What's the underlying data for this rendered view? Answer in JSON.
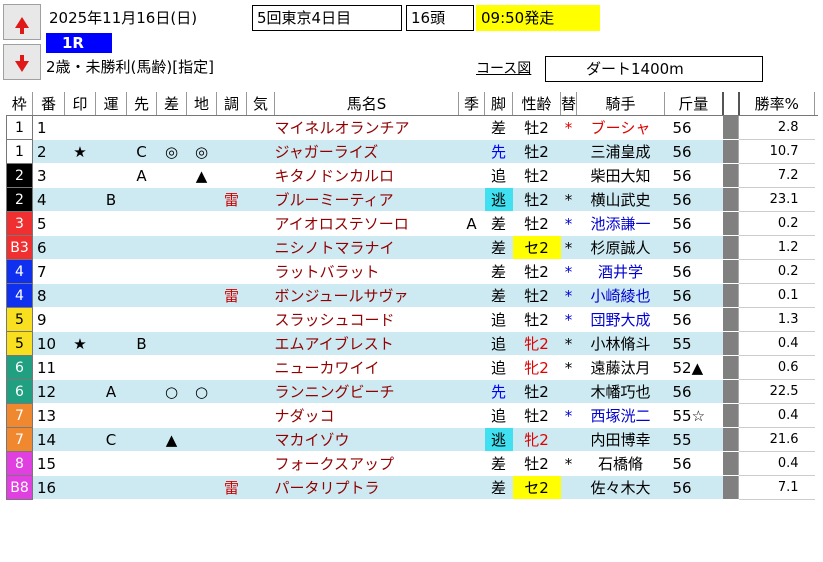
{
  "race": {
    "date": "2025年11月16日(日)",
    "meeting": "5回東京4日目",
    "runners": "16頭",
    "start": "09:50発走",
    "number": "1R",
    "condition": "2歳・未勝利(馬齢)[指定]",
    "course_link": "コース図",
    "course": "ダート1400m"
  },
  "colors": {
    "start_bg": "#ffff00",
    "race_num_bg": "#0000ff",
    "alt_row_bg": "#cdeaf2",
    "name_color": "#900000",
    "apprentice_color": "#0000d0"
  },
  "columns": [
    "枠",
    "番",
    "印",
    "運",
    "先",
    "差",
    "地",
    "調",
    "気",
    "馬名S",
    "季",
    "脚",
    "性齢",
    "替",
    "騎手",
    "斤量",
    "",
    "勝率%"
  ],
  "rows": [
    {
      "waku": "1",
      "wakuBg": "#ffffff",
      "wakuFg": "#000000",
      "num": "1",
      "in": "",
      "un": "",
      "sen": "",
      "sa": "",
      "chi": "",
      "cho": "",
      "ki": "",
      "name": "マイネルオランチア",
      "kisetsu": "",
      "style": "差",
      "styleBg": "",
      "styleFg": "#000000",
      "sex": "牡2",
      "sexBg": "",
      "sexFg": "#000000",
      "kae": "*",
      "jockey": "ブーシャ",
      "jockeyFg": "#e00000",
      "weight": "56",
      "odds": "2.8"
    },
    {
      "waku": "1",
      "wakuBg": "#ffffff",
      "wakuFg": "#000000",
      "num": "2",
      "in": "★",
      "un": "",
      "sen": "C",
      "sa": "◎",
      "chi": "◎",
      "cho": "",
      "ki": "",
      "name": "ジャガーライズ",
      "kisetsu": "",
      "style": "先",
      "styleBg": "",
      "styleFg": "#0000ff",
      "sex": "牡2",
      "sexBg": "",
      "sexFg": "#000000",
      "kae": "",
      "jockey": "三浦皇成",
      "jockeyFg": "#000000",
      "weight": "56",
      "odds": "10.7"
    },
    {
      "waku": "2",
      "wakuBg": "#000000",
      "wakuFg": "#ffffff",
      "num": "3",
      "in": "",
      "un": "",
      "sen": "A",
      "sa": "",
      "chi": "▲",
      "cho": "",
      "ki": "",
      "name": "キタノドンカルロ",
      "kisetsu": "",
      "style": "追",
      "styleBg": "",
      "styleFg": "#000000",
      "sex": "牡2",
      "sexBg": "",
      "sexFg": "#000000",
      "kae": "",
      "jockey": "柴田大知",
      "jockeyFg": "#000000",
      "weight": "56",
      "odds": "7.2"
    },
    {
      "waku": "2",
      "wakuBg": "#000000",
      "wakuFg": "#ffffff",
      "num": "4",
      "in": "",
      "un": "B",
      "sen": "",
      "sa": "",
      "chi": "",
      "cho": "雷",
      "ki": "",
      "name": "ブルーミーティア",
      "kisetsu": "",
      "style": "逃",
      "styleBg": "#40e0f0",
      "styleFg": "#000000",
      "sex": "牡2",
      "sexBg": "",
      "sexFg": "#000000",
      "kae": "*",
      "jockey": "横山武史",
      "jockeyFg": "#000000",
      "weight": "56",
      "odds": "23.1"
    },
    {
      "waku": "3",
      "wakuBg": "#f03030",
      "wakuFg": "#ffffff",
      "num": "5",
      "in": "",
      "un": "",
      "sen": "",
      "sa": "",
      "chi": "",
      "cho": "",
      "ki": "",
      "name": "アイオロステソーロ",
      "kisetsu": "A",
      "style": "差",
      "styleBg": "",
      "styleFg": "#000000",
      "sex": "牡2",
      "sexBg": "",
      "sexFg": "#000000",
      "kae": "*",
      "jockey": "池添謙一",
      "jockeyFg": "#0000d0",
      "weight": "56",
      "odds": "0.2"
    },
    {
      "waku": "B3",
      "wakuBg": "#f03030",
      "wakuFg": "#ffffff",
      "num": "6",
      "in": "",
      "un": "",
      "sen": "",
      "sa": "",
      "chi": "",
      "cho": "",
      "ki": "",
      "name": "ニシノトマラナイ",
      "kisetsu": "",
      "style": "差",
      "styleBg": "",
      "styleFg": "#000000",
      "sex": "セ2",
      "sexBg": "#ffff00",
      "sexFg": "#000000",
      "kae": "*",
      "jockey": "杉原誠人",
      "jockeyFg": "#000000",
      "weight": "56",
      "odds": "1.2"
    },
    {
      "waku": "4",
      "wakuBg": "#1030f0",
      "wakuFg": "#ffffff",
      "num": "7",
      "in": "",
      "un": "",
      "sen": "",
      "sa": "",
      "chi": "",
      "cho": "",
      "ki": "",
      "name": "ラットバラット",
      "kisetsu": "",
      "style": "差",
      "styleBg": "",
      "styleFg": "#000000",
      "sex": "牡2",
      "sexBg": "",
      "sexFg": "#000000",
      "kae": "*",
      "jockey": "酒井学",
      "jockeyFg": "#0000d0",
      "weight": "56",
      "odds": "0.2"
    },
    {
      "waku": "4",
      "wakuBg": "#1030f0",
      "wakuFg": "#ffffff",
      "num": "8",
      "in": "",
      "un": "",
      "sen": "",
      "sa": "",
      "chi": "",
      "cho": "雷",
      "ki": "",
      "name": "ボンジュールサヴァ",
      "kisetsu": "",
      "style": "差",
      "styleBg": "",
      "styleFg": "#000000",
      "sex": "牡2",
      "sexBg": "",
      "sexFg": "#000000",
      "kae": "*",
      "jockey": "小崎綾也",
      "jockeyFg": "#0000d0",
      "weight": "56",
      "odds": "0.1"
    },
    {
      "waku": "5",
      "wakuBg": "#f8e020",
      "wakuFg": "#000000",
      "num": "9",
      "in": "",
      "un": "",
      "sen": "",
      "sa": "",
      "chi": "",
      "cho": "",
      "ki": "",
      "name": "スラッシュコード",
      "kisetsu": "",
      "style": "追",
      "styleBg": "",
      "styleFg": "#000000",
      "sex": "牡2",
      "sexBg": "",
      "sexFg": "#000000",
      "kae": "*",
      "jockey": "団野大成",
      "jockeyFg": "#0000d0",
      "weight": "56",
      "odds": "1.3"
    },
    {
      "waku": "5",
      "wakuBg": "#f8e020",
      "wakuFg": "#000000",
      "num": "10",
      "in": "★",
      "un": "",
      "sen": "B",
      "sa": "",
      "chi": "",
      "cho": "",
      "ki": "",
      "name": "エムアイブレスト",
      "kisetsu": "",
      "style": "追",
      "styleBg": "",
      "styleFg": "#000000",
      "sex": "牝2",
      "sexBg": "",
      "sexFg": "#e00000",
      "kae": "*",
      "jockey": "小林脩斗",
      "jockeyFg": "#000000",
      "weight": "55",
      "odds": "0.4"
    },
    {
      "waku": "6",
      "wakuBg": "#20a080",
      "wakuFg": "#ffffff",
      "num": "11",
      "in": "",
      "un": "",
      "sen": "",
      "sa": "",
      "chi": "",
      "cho": "",
      "ki": "",
      "name": "ニューカワイイ",
      "kisetsu": "",
      "style": "追",
      "styleBg": "",
      "styleFg": "#000000",
      "sex": "牝2",
      "sexBg": "",
      "sexFg": "#e00000",
      "kae": "*",
      "jockey": "遠藤汰月",
      "jockeyFg": "#000000",
      "weight": "52▲",
      "odds": "0.6"
    },
    {
      "waku": "6",
      "wakuBg": "#20a080",
      "wakuFg": "#ffffff",
      "num": "12",
      "in": "",
      "un": "A",
      "sen": "",
      "sa": "○",
      "chi": "○",
      "cho": "",
      "ki": "",
      "name": "ランニングビーチ",
      "kisetsu": "",
      "style": "先",
      "styleBg": "",
      "styleFg": "#0000ff",
      "sex": "牡2",
      "sexBg": "",
      "sexFg": "#000000",
      "kae": "",
      "jockey": "木幡巧也",
      "jockeyFg": "#000000",
      "weight": "56",
      "odds": "22.5"
    },
    {
      "waku": "7",
      "wakuBg": "#f08830",
      "wakuFg": "#ffffff",
      "num": "13",
      "in": "",
      "un": "",
      "sen": "",
      "sa": "",
      "chi": "",
      "cho": "",
      "ki": "",
      "name": "ナダッコ",
      "kisetsu": "",
      "style": "追",
      "styleBg": "",
      "styleFg": "#000000",
      "sex": "牡2",
      "sexBg": "",
      "sexFg": "#000000",
      "kae": "*",
      "jockey": "西塚洸二",
      "jockeyFg": "#0000d0",
      "weight": "55☆",
      "odds": "0.4"
    },
    {
      "waku": "7",
      "wakuBg": "#f08830",
      "wakuFg": "#ffffff",
      "num": "14",
      "in": "",
      "un": "C",
      "sen": "",
      "sa": "▲",
      "chi": "",
      "cho": "",
      "ki": "",
      "name": "マカイゾウ",
      "kisetsu": "",
      "style": "逃",
      "styleBg": "#40e0f0",
      "styleFg": "#000000",
      "sex": "牝2",
      "sexBg": "",
      "sexFg": "#e00000",
      "kae": "",
      "jockey": "内田博幸",
      "jockeyFg": "#000000",
      "weight": "55",
      "odds": "21.6"
    },
    {
      "waku": "8",
      "wakuBg": "#e040e0",
      "wakuFg": "#ffffff",
      "num": "15",
      "in": "",
      "un": "",
      "sen": "",
      "sa": "",
      "chi": "",
      "cho": "",
      "ki": "",
      "name": "フォークスアップ",
      "kisetsu": "",
      "style": "差",
      "styleBg": "",
      "styleFg": "#000000",
      "sex": "牡2",
      "sexBg": "",
      "sexFg": "#000000",
      "kae": "*",
      "jockey": "石橋脩",
      "jockeyFg": "#000000",
      "weight": "56",
      "odds": "0.4"
    },
    {
      "waku": "B8",
      "wakuBg": "#e040e0",
      "wakuFg": "#ffffff",
      "num": "16",
      "in": "",
      "un": "",
      "sen": "",
      "sa": "",
      "chi": "",
      "cho": "雷",
      "ki": "",
      "name": "パータリプトラ",
      "kisetsu": "",
      "style": "差",
      "styleBg": "",
      "styleFg": "#000000",
      "sex": "セ2",
      "sexBg": "#ffff00",
      "sexFg": "#000000",
      "kae": "",
      "jockey": "佐々木大",
      "jockeyFg": "#000000",
      "weight": "56",
      "odds": "7.1"
    }
  ]
}
